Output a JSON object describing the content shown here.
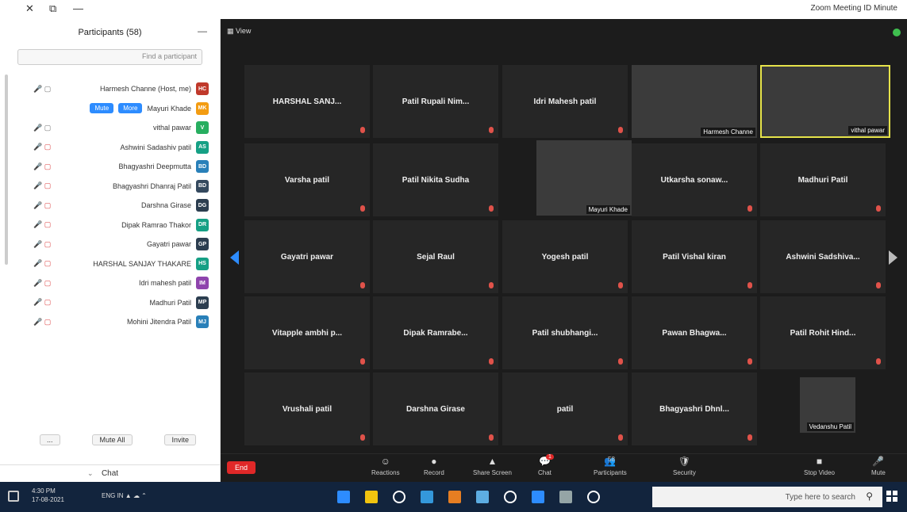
{
  "window": {
    "title": "Zoom Meeting ID Minute",
    "controls": [
      "✕",
      "⧉",
      "—"
    ]
  },
  "participants_panel": {
    "title": "Participants (58)",
    "search_placeholder": "Find a participant",
    "rows": [
      {
        "name": "Harmesh Channe (Host, me)",
        "avatar": "HC",
        "color": "#c0392b",
        "icons": "🎤 ▢",
        "muted": false
      },
      {
        "name": "Mayuri Khade",
        "avatar": "MK",
        "color": "#f39c12",
        "icons": "",
        "muted": false,
        "buttons": [
          "Mute",
          "More"
        ]
      },
      {
        "name": "vithal pawar",
        "avatar": "V",
        "color": "#27ae60",
        "icons": "🎤 ▢",
        "muted": false
      },
      {
        "name": "Ashwini Sadashiv patil",
        "avatar": "AS",
        "color": "#16a085",
        "icons": "🎤 ▢",
        "muted": true
      },
      {
        "name": "Bhagyashri Deepmutta",
        "avatar": "BD",
        "color": "#2980b9",
        "icons": "🎤 ▢",
        "muted": true
      },
      {
        "name": "Bhagyashri Dhanraj Patil",
        "avatar": "BD",
        "color": "#34495e",
        "icons": "🎤 ▢",
        "muted": true
      },
      {
        "name": "Darshna Girase",
        "avatar": "DG",
        "color": "#2c3e50",
        "icons": "🎤 ▢",
        "muted": true
      },
      {
        "name": "Dipak Ramrao Thakor",
        "avatar": "DR",
        "color": "#16a085",
        "icons": "🎤 ▢",
        "muted": true
      },
      {
        "name": "Gayatri pawar",
        "avatar": "GP",
        "color": "#2c3e50",
        "icons": "🎤 ▢",
        "muted": true
      },
      {
        "name": "HARSHAL SANJAY THAKARE",
        "avatar": "HS",
        "color": "#16a085",
        "icons": "🎤 ▢",
        "muted": true
      },
      {
        "name": "Idri mahesh patil",
        "avatar": "IM",
        "color": "#8e44ad",
        "icons": "🎤 ▢",
        "muted": true
      },
      {
        "name": "Madhuri Patil",
        "avatar": "MP",
        "color": "#2c3e50",
        "icons": "🎤 ▢",
        "muted": true
      },
      {
        "name": "Mohini Jitendra Patil",
        "avatar": "MJ",
        "color": "#2980b9",
        "icons": "🎤 ▢",
        "muted": true
      }
    ],
    "footer": {
      "invite": "Invite",
      "mute_all": "Mute All",
      "more": "..."
    },
    "chat_label": "Chat"
  },
  "video": {
    "view_label": "▦ View",
    "tiles": [
      {
        "label": "HARSHAL SANJ...",
        "type": "name"
      },
      {
        "label": "Patil Rupali Nim...",
        "type": "name"
      },
      {
        "label": "Idri Mahesh patil",
        "type": "name"
      },
      {
        "label": "Harmesh Channe",
        "type": "camera"
      },
      {
        "label": "vithal pawar",
        "type": "camera"
      },
      {
        "label": "Varsha patil",
        "type": "name"
      },
      {
        "label": "Patil Nikita Sudha",
        "type": "name"
      },
      {
        "label": "Mayuri Khade",
        "type": "camera"
      },
      {
        "label": "Utkarsha sonaw...",
        "type": "name"
      },
      {
        "label": "Madhuri Patil",
        "type": "name"
      },
      {
        "label": "Gayatri pawar",
        "type": "name"
      },
      {
        "label": "Sejal Raul",
        "type": "name"
      },
      {
        "label": "Yogesh patil",
        "type": "name"
      },
      {
        "label": "Patil Vishal kiran",
        "type": "name"
      },
      {
        "label": "Ashwini Sadshiva...",
        "type": "name"
      },
      {
        "label": "Vitapple ambhi p...",
        "type": "name"
      },
      {
        "label": "Dipak Ramrabe...",
        "type": "name"
      },
      {
        "label": "Patil shubhangi...",
        "type": "name"
      },
      {
        "label": "Pawan Bhagwa...",
        "type": "name"
      },
      {
        "label": "Patil Rohit Hind...",
        "type": "name"
      },
      {
        "label": "Vrushali patil",
        "type": "name"
      },
      {
        "label": "Darshna Girase",
        "type": "name"
      },
      {
        "label": "patil",
        "type": "name"
      },
      {
        "label": "Bhagyashri Dhnl...",
        "type": "name"
      },
      {
        "label": "Vedanshu Patil",
        "type": "camera"
      }
    ]
  },
  "toolbar": {
    "end": "End",
    "items": [
      {
        "label": "Reactions",
        "icon": "☺"
      },
      {
        "label": "Record",
        "icon": "●"
      },
      {
        "label": "Share Screen",
        "icon": "▲"
      },
      {
        "label": "Chat",
        "icon": "💬",
        "badge": "1"
      },
      {
        "label": "Participants",
        "icon": "👥",
        "count": "58"
      },
      {
        "label": "Security",
        "icon": "🛡"
      },
      {
        "label": "Stop Video",
        "icon": "■"
      },
      {
        "label": "Mute",
        "icon": "🎤"
      }
    ]
  },
  "taskbar": {
    "search_placeholder": "Type here to search",
    "time": "4:30 PM",
    "date": "17-08-2021",
    "lang": "ENG",
    "tray": "IN ▲ ☁ ⌃",
    "apps_colors": [
      "#2d8cff",
      "#f1c40f",
      "#ffffff",
      "#3498db",
      "#e67e22",
      "#5dade2",
      "#ffffff",
      "#2d8cff",
      "#95a5a6",
      "#ffffff"
    ]
  }
}
